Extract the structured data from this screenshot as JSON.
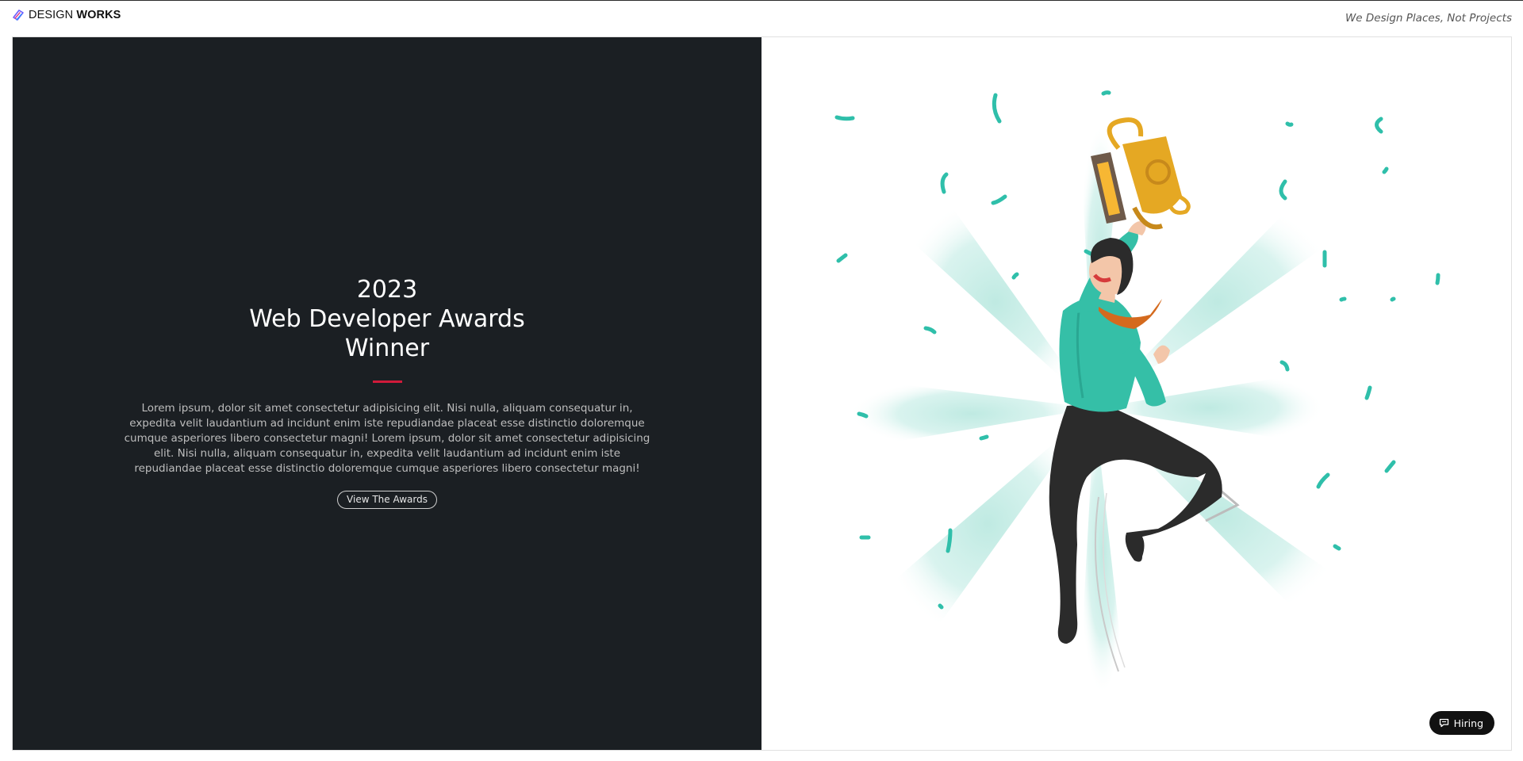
{
  "header": {
    "brand_light": "DESIGN ",
    "brand_bold": "WORKS",
    "logo_icon": "design-works-logo-icon",
    "tagline": "We Design Places, Not Projects"
  },
  "hero": {
    "title_lines": [
      "2023",
      "Web Developer Awards",
      "Winner"
    ],
    "body": "Lorem ipsum, dolor sit amet consectetur adipisicing elit. Nisi nulla, aliquam consequatur in, expedita velit laudantium ad incidunt enim iste repudiandae placeat esse distinctio doloremque cumque asperiores libero consectetur magni! Lorem ipsum, dolor sit amet consectetur adipisicing elit. Nisi nulla, aliquam consequatur in, expedita velit laudantium ad incidunt enim iste repudiandae placeat esse distinctio doloremque cumque asperiores libero consectetur magni!",
    "cta_label": "View The Awards",
    "accent_color": "#d11a3a",
    "panel_color": "#1b1f23"
  },
  "illustration": {
    "subject": "celebrating-person-with-trophy",
    "confetti_color": "#2fbfaa",
    "trophy_color": "#e5a823",
    "shirt_color": "#35bfa7"
  },
  "floating": {
    "hiring_label": "Hiring",
    "hiring_icon": "chat-icon"
  }
}
